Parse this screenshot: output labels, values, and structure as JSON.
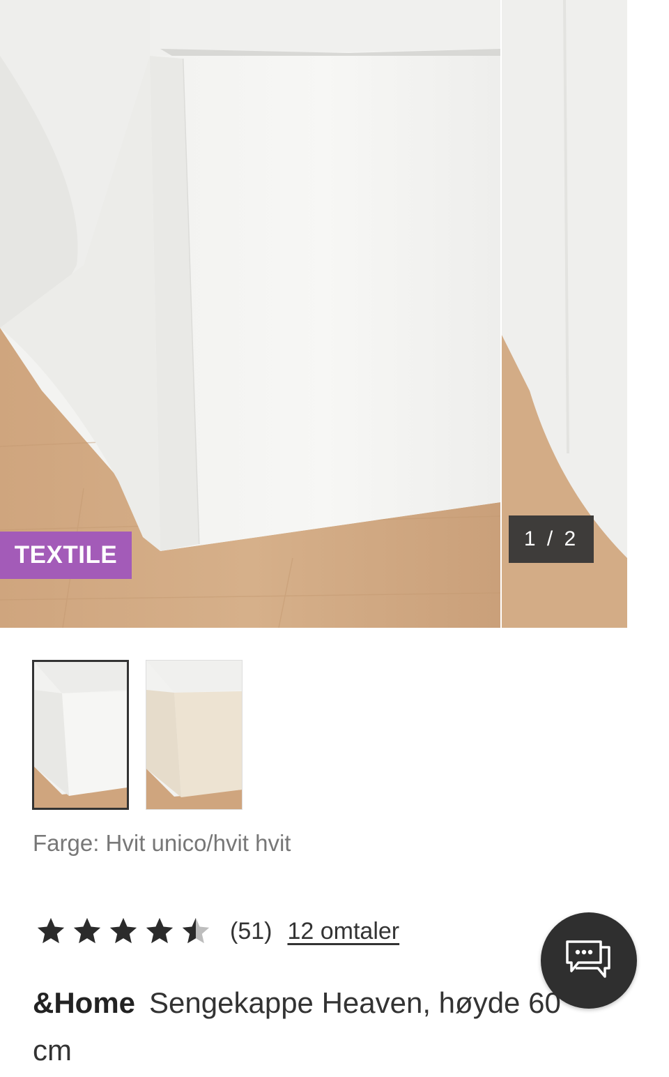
{
  "gallery": {
    "badge": "TEXTILE",
    "counter": "1 / 2",
    "colors": {
      "badge": "#a35bb8",
      "counter_bg": "#3e3c3a"
    }
  },
  "thumbnails": [
    {
      "label": "Hvit",
      "active": true
    },
    {
      "label": "Beige",
      "active": false
    }
  ],
  "color": {
    "label": "Farge: Hvit unico/hvit hvit"
  },
  "rating": {
    "stars": 4.5,
    "count_text": "(51)",
    "reviews_link": "12 omtaler"
  },
  "product": {
    "brand": "&Home",
    "name": "Sengekappe Heaven, høyde 60 cm"
  },
  "chat": {
    "icon": "chat-bubbles-icon"
  }
}
